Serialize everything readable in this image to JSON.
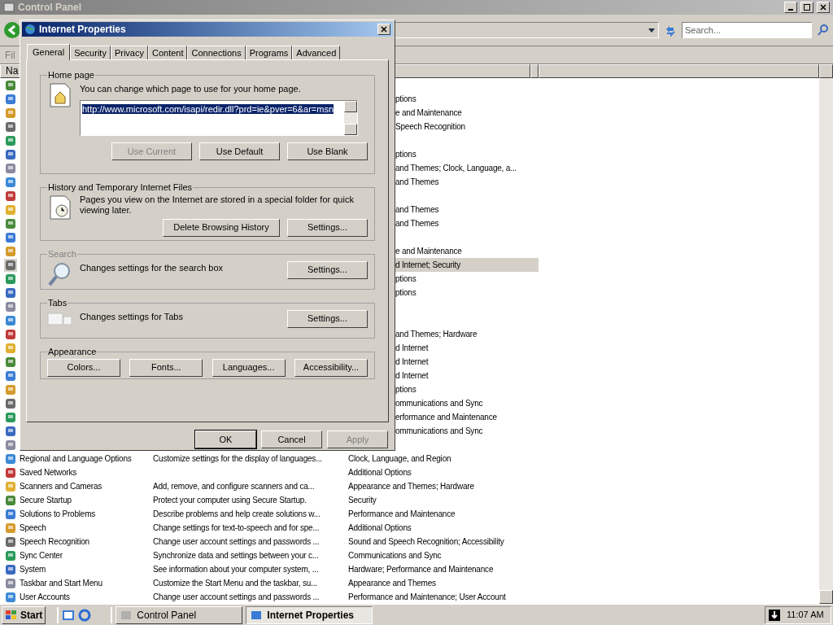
{
  "window": {
    "title": "Control Panel"
  },
  "address_bar": {
    "search_placeholder": "Search..."
  },
  "menu_bar": [
    "Fil"
  ],
  "list": {
    "columns": [
      "Na"
    ],
    "rows": [
      {
        "selected": false
      },
      {
        "category_part": "ptions",
        "selected": false
      },
      {
        "category_part": "e and Maintenance",
        "selected": false
      },
      {
        "category_part": "Speech Recognition",
        "selected": false
      },
      {
        "selected": false
      },
      {
        "category_part": "ptions",
        "selected": false
      },
      {
        "category_part": "and Themes; Clock, Language, a...",
        "selected": false
      },
      {
        "category_part": "and Themes",
        "selected": false
      },
      {
        "selected": false
      },
      {
        "category_part": "and Themes",
        "selected": false
      },
      {
        "category_part": "and Themes",
        "selected": false
      },
      {
        "selected": false
      },
      {
        "category_part": "e and Maintenance",
        "selected": false
      },
      {
        "category_part": "d Internet; Security",
        "selected": true
      },
      {
        "category_part": "ptions",
        "selected": false
      },
      {
        "category_part": "ptions",
        "selected": false
      },
      {
        "selected": false
      },
      {
        "selected": false
      },
      {
        "category_part": "and Themes; Hardware",
        "selected": false
      },
      {
        "category_part": "d Internet",
        "selected": false
      },
      {
        "category_part": "d Internet",
        "selected": false
      },
      {
        "category_part": "d Internet",
        "selected": false
      },
      {
        "category_part": "ptions",
        "selected": false
      },
      {
        "category_part": "ommunications and Sync",
        "selected": false
      },
      {
        "category_part": "erformance and Maintenance",
        "selected": false
      },
      {
        "category_part": "ommunications and Sync",
        "selected": false
      },
      {
        "selected": false
      },
      {
        "name": "Regional and Language Options",
        "description": "Customize settings for the display of languages...",
        "category": "Clock, Language, and Region",
        "selected": false
      },
      {
        "name": "Saved Networks",
        "category": "Additional Options",
        "selected": false
      },
      {
        "name": "Scanners and Cameras",
        "description": "Add, remove, and configure scanners and ca...",
        "category": "Appearance and Themes; Hardware",
        "selected": false
      },
      {
        "name": "Secure Startup",
        "description": "Protect your computer using Secure Startup.",
        "category": "Security",
        "selected": false
      },
      {
        "name": "Solutions to Problems",
        "description": "Describe problems and help create solutions w...",
        "category": "Performance and Maintenance",
        "selected": false
      },
      {
        "name": "Speech",
        "description": "Change settings for text-to-speech and for spe...",
        "category": "Additional Options",
        "selected": false
      },
      {
        "name": "Speech Recognition",
        "description": "Change user account settings and passwords ...",
        "category": "Sound and Speech Recognition; Accessibility",
        "selected": false
      },
      {
        "name": "Sync Center",
        "description": "Synchronize data and settings between your c...",
        "category": "Communications and Sync",
        "selected": false
      },
      {
        "name": "System",
        "description": "See information about your computer system, ...",
        "category": "Hardware; Performance and Maintenance",
        "selected": false
      },
      {
        "name": "Taskbar and Start Menu",
        "description": "Customize the Start Menu and the taskbar, su...",
        "category": "Appearance and Themes",
        "selected": false
      },
      {
        "name": "User Accounts",
        "description": "Change user account settings and passwords ...",
        "category": "Performance and Maintenance; User Account",
        "selected": false
      }
    ]
  },
  "dialog": {
    "title": "Internet Properties",
    "tabs": [
      {
        "label": "General",
        "selected": true
      },
      {
        "label": "Security",
        "selected": false
      },
      {
        "label": "Privacy",
        "selected": false
      },
      {
        "label": "Content",
        "selected": false
      },
      {
        "label": "Connections",
        "selected": false
      },
      {
        "label": "Programs",
        "selected": false
      },
      {
        "label": "Advanced",
        "selected": false
      }
    ],
    "home_page": {
      "legend": "Home page",
      "text": "You can change which page to use for your home page.",
      "url": "http://www.microsoft.com/isapi/redir.dll?prd=ie&pver=6&ar=msn",
      "buttons": [
        {
          "label": "Use Current",
          "disabled": true
        },
        {
          "label": "Use Default",
          "disabled": false
        },
        {
          "label": "Use Blank",
          "disabled": false
        }
      ]
    },
    "history": {
      "legend": "History and Temporary Internet Files",
      "text": "Pages you view on the Internet are stored in a special folder for quick viewing later.",
      "buttons": [
        {
          "label": "Delete Browsing History",
          "disabled": false
        },
        {
          "label": "Settings...",
          "disabled": false
        }
      ]
    },
    "search": {
      "legend": "Search",
      "disabled": true,
      "text": "Changes settings for the search box",
      "button": "Settings..."
    },
    "tabs_group": {
      "legend": "Tabs",
      "disabled": false,
      "text": "Changes settings for Tabs",
      "button": "Settings..."
    },
    "appearance": {
      "legend": "Appearance",
      "buttons": [
        "Colors...",
        "Fonts...",
        "Languages...",
        "Accessibility..."
      ]
    },
    "footer_buttons": [
      {
        "label": "OK",
        "disabled": false,
        "default": true
      },
      {
        "label": "Cancel",
        "disabled": false,
        "default": false
      },
      {
        "label": "Apply",
        "disabled": true,
        "default": false
      }
    ]
  },
  "taskbar": {
    "start": "Start",
    "buttons": [
      {
        "label": "Control Panel",
        "selected": false
      },
      {
        "label": "Internet Properties",
        "selected": true
      }
    ],
    "clock": "11:07 AM"
  }
}
